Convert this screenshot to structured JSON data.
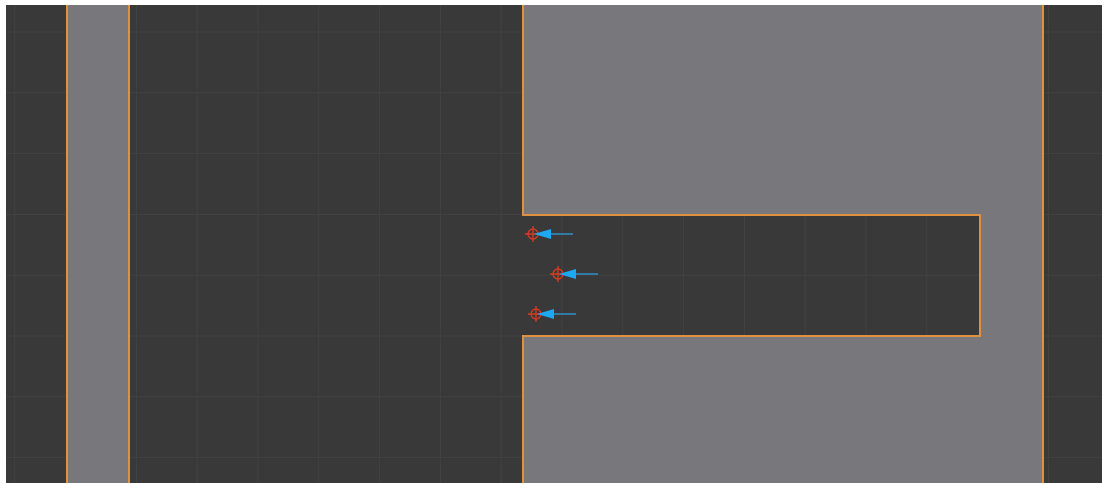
{
  "viewport": {
    "markers": [
      {
        "kind": "force-field"
      },
      {
        "kind": "force-field"
      },
      {
        "kind": "force-field"
      }
    ]
  }
}
